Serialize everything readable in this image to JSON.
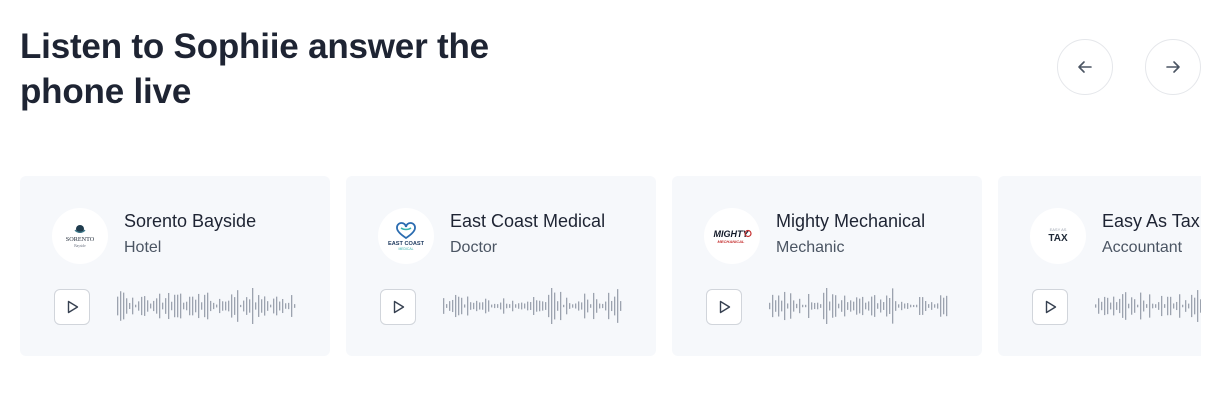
{
  "header": {
    "title": "Listen to Sophiie answer the phone live"
  },
  "nav": {
    "prev_icon": "arrow-left-icon",
    "next_icon": "arrow-right-icon"
  },
  "cards": [
    {
      "name": "Sorento Bayside",
      "category": "Hotel",
      "logo_icon": "sorento-bayside-logo",
      "logo_text": "SORENTO",
      "logo_subtext": "Bayside"
    },
    {
      "name": "East Coast Medical",
      "category": "Doctor",
      "logo_icon": "east-coast-medical-logo",
      "logo_text": "EAST COAST",
      "logo_subtext": "MEDICAL"
    },
    {
      "name": "Mighty Mechanical",
      "category": "Mechanic",
      "logo_icon": "mighty-mechanical-logo",
      "logo_text": "MIGHTY",
      "logo_subtext": "MECHANICAL"
    },
    {
      "name": "Easy As Tax",
      "category": "Accountant",
      "logo_icon": "easy-as-tax-logo",
      "logo_text": "TAX",
      "logo_subtext": "EASY AS"
    }
  ],
  "colors": {
    "card_bg": "#f6f8fb",
    "waveform": "#9ca3af",
    "heading": "#1e2433"
  }
}
